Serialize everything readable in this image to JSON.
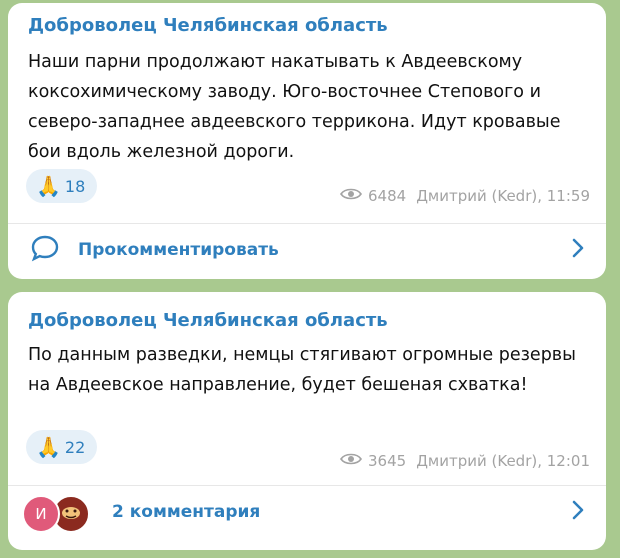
{
  "posts": [
    {
      "channel": "Доброволец Челябинская область",
      "text": "Наши парни продолжают накатывать к Авдеевскому коксохимическому заводу. Юго-восточнее Степового и северо-западнее авдеевского терриконa. Идут кровавые бои вдоль железной дороги.",
      "reaction_emoji": "🙏",
      "reaction_count": "18",
      "views": "6484",
      "author_time": "Дмитрий (Kedr), 11:59",
      "comment_label": "Прокомментировать",
      "icon_comment": "comment-bubble-icon"
    },
    {
      "channel": "Доброволец Челябинская область",
      "text": "По данным разведки, немцы стягивают огромные резервы на Авдеевское направление, будет бешеная схватка!",
      "reaction_emoji": "🙏",
      "reaction_count": "22",
      "views": "3645",
      "author_time": "Дмитрий (Kedr), 12:01",
      "comment_label": "2 комментария",
      "avatar_1_letter": "И",
      "avatar_1_color": "#e05a7a",
      "avatar_2_color": "#8b2a1f"
    }
  ],
  "colors": {
    "background": "#a9c98f",
    "accent": "#2f7fbd",
    "meta": "#a3a3a3"
  }
}
